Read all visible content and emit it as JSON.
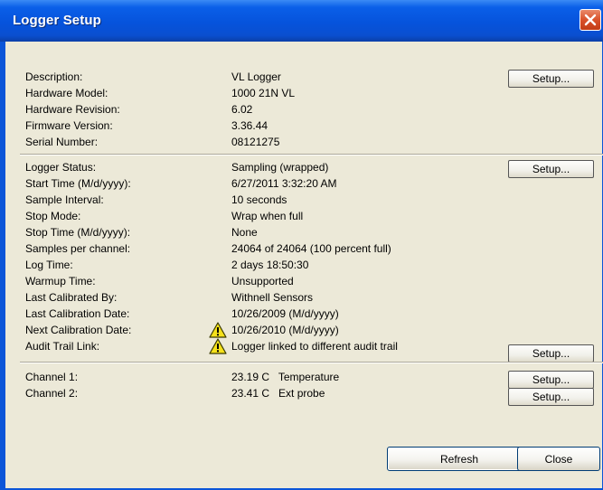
{
  "window": {
    "title": "Logger Setup"
  },
  "buttons": {
    "setup_label": "Setup...",
    "refresh": "Refresh",
    "close": "Close"
  },
  "info": [
    {
      "label": "Description:",
      "value": "VL Logger"
    },
    {
      "label": "Hardware Model:",
      "value": "1000 21N VL"
    },
    {
      "label": "Hardware Revision:",
      "value": "6.02"
    },
    {
      "label": "Firmware Version:",
      "value": "3.36.44"
    },
    {
      "label": "Serial Number:",
      "value": "08121275"
    }
  ],
  "status": [
    {
      "label": "Logger Status:",
      "value": "Sampling (wrapped)"
    },
    {
      "label": "Start Time (M/d/yyyy):",
      "value": "6/27/2011 3:32:20 AM"
    },
    {
      "label": "Sample Interval:",
      "value": "10 seconds"
    },
    {
      "label": "Stop Mode:",
      "value": "Wrap when full"
    },
    {
      "label": "Stop Time (M/d/yyyy):",
      "value": "None"
    },
    {
      "label": "Samples per channel:",
      "value": "24064 of 24064  (100 percent full)"
    },
    {
      "label": "Log Time:",
      "value": "2 days 18:50:30"
    },
    {
      "label": "Warmup Time:",
      "value": "Unsupported"
    },
    {
      "label": "Last Calibrated By:",
      "value": "Withnell Sensors"
    },
    {
      "label": "Last Calibration Date:",
      "value": "10/26/2009  (M/d/yyyy)"
    },
    {
      "label": "Next Calibration Date:",
      "value": "10/26/2010  (M/d/yyyy)"
    },
    {
      "label": "Audit Trail Link:",
      "value": "Logger linked to different audit trail"
    }
  ],
  "channels": [
    {
      "label": "Channel 1:",
      "value": "23.19 C   Temperature"
    },
    {
      "label": "Channel 2:",
      "value": "23.41 C   Ext probe"
    }
  ],
  "colors": {
    "titlebar": "#0653dc",
    "client_bg": "#ece9d8",
    "warning": "#f5e11b"
  },
  "icons": {
    "warning": "warning-icon",
    "close": "close-icon"
  }
}
